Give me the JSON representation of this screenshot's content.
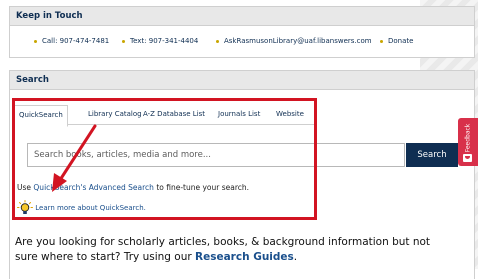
{
  "keep_in_touch": {
    "title": "Keep in Touch",
    "call": "Call: 907-474-7481",
    "text": "Text: 907-341-4404",
    "email": "AskRasmusonLibrary@uaf.libanswers.com",
    "donate": "Donate"
  },
  "search_box": {
    "title": "Search",
    "tabs": [
      "QuickSearch",
      "Library Catalog",
      "A-Z Database List",
      "Journals List",
      "Website"
    ],
    "input_placeholder": "Search books, articles, media and more...",
    "button_label": "Search",
    "advanced_prefix": "Use ",
    "advanced_link": "QuickSearch's Advanced Search",
    "advanced_suffix": " to fine-tune your search.",
    "learn_more_link": "Learn more about QuickSearch."
  },
  "promo": {
    "text": "Are you looking for scholarly articles, books, & background information but not sure where to start? Try using our ",
    "link": "Research Guides",
    "end": "."
  },
  "feedback": {
    "label": "Feedback"
  },
  "colors": {
    "brand_navy": "#0f2e52",
    "annotation_red": "#d21422",
    "feedback_pink": "#d8304a"
  },
  "icons": [
    "lightbulb-icon",
    "annotation-arrow",
    "feedback-icon"
  ]
}
